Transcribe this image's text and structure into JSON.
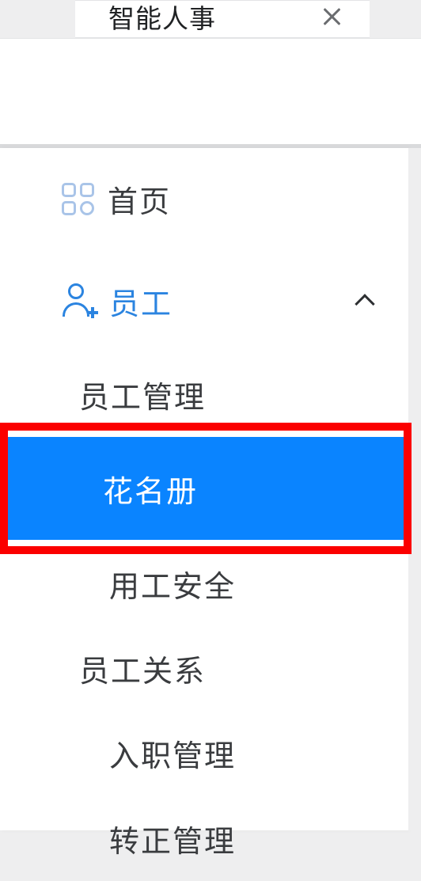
{
  "header": {
    "tab_title": "智能人事"
  },
  "sidebar": {
    "home": {
      "label": "首页"
    },
    "staff": {
      "label": "员工",
      "management": "员工管理",
      "roster": "花名册",
      "safety": "用工安全",
      "relations": "员工关系",
      "onboarding": "入职管理",
      "regularization": "转正管理"
    }
  }
}
